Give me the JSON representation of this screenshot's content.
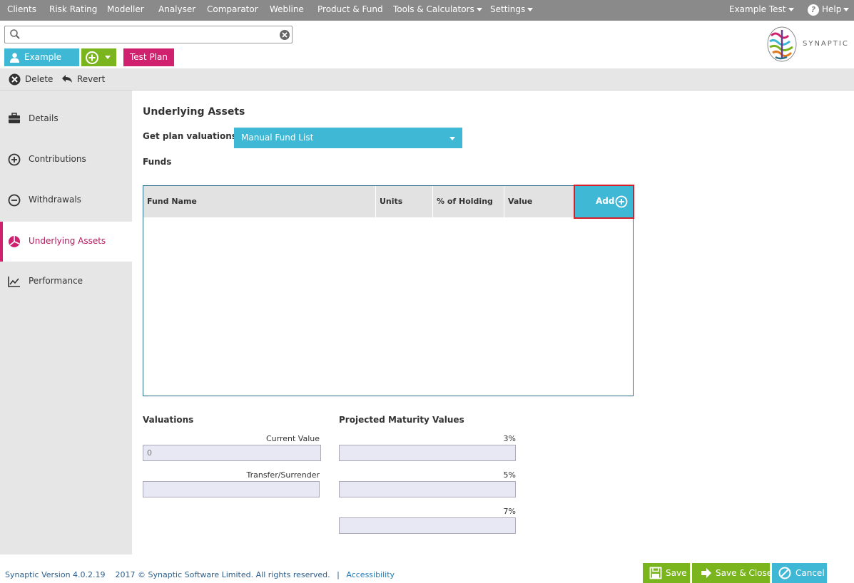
{
  "topnav": {
    "items": [
      "Clients",
      "Risk Rating",
      "Modeller",
      "Analyser",
      "Comparator",
      "Webline",
      "Product & Fund",
      "Tools & Calculators",
      "Settings"
    ],
    "user": "Example Test",
    "help": "Help"
  },
  "search": {
    "value": "",
    "placeholder": ""
  },
  "logo": {
    "brand": "SYNAPTIC"
  },
  "context": {
    "client": "Example Test",
    "plan": "Test Plan"
  },
  "toolbar": {
    "delete": "Delete",
    "revert": "Revert"
  },
  "sidebar": {
    "items": [
      {
        "label": "Details",
        "icon": "briefcase-icon"
      },
      {
        "label": "Contributions",
        "icon": "plus-circle-icon"
      },
      {
        "label": "Withdrawals",
        "icon": "minus-circle-icon"
      },
      {
        "label": "Underlying Assets",
        "icon": "pie-chart-icon",
        "active": true
      },
      {
        "label": "Performance",
        "icon": "line-chart-icon"
      }
    ]
  },
  "main": {
    "title": "Underlying Assets",
    "valuations_label": "Get plan valuations:",
    "valuations_select": "Manual Fund List",
    "funds_label": "Funds",
    "table": {
      "columns": [
        "Fund Name",
        "Units",
        "% of Holding",
        "Value"
      ],
      "add_label": "Add",
      "rows": []
    },
    "valuations": {
      "title": "Valuations",
      "current_value_label": "Current Value",
      "current_value": "0",
      "transfer_label": "Transfer/Surrender",
      "transfer_value": ""
    },
    "projected": {
      "title": "Projected Maturity Values",
      "rates": [
        "3%",
        "5%",
        "7%"
      ]
    }
  },
  "footer": {
    "version": "Synaptic Version 4.0.2.19",
    "copyright": "2017 © Synaptic Software Limited. All rights reserved.",
    "separator": "|",
    "accessibility": "Accessibility",
    "save": "Save",
    "save_close": "Save & Close",
    "cancel": "Cancel"
  },
  "colors": {
    "nav_bg": "#8a8a8a",
    "accent_blue": "#3fb8d6",
    "accent_green": "#7ab51d",
    "accent_magenta": "#d0216e",
    "highlight_red": "#d61f26"
  }
}
